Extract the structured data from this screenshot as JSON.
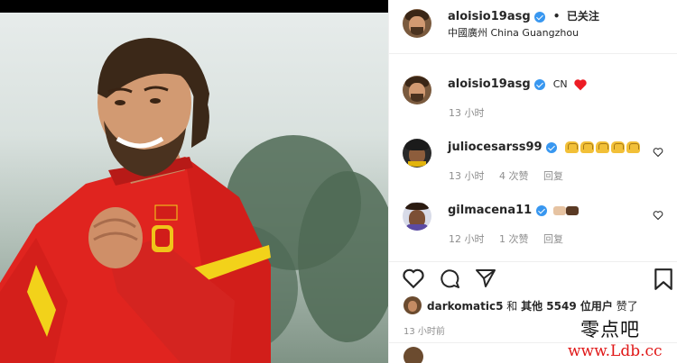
{
  "header": {
    "username": "aloisio19asg",
    "separator": "•",
    "follow_state": "已关注",
    "location": "中國廣州 China Guangzhou"
  },
  "caption": {
    "username": "aloisio19asg",
    "text": "CN",
    "time": "13 小时"
  },
  "comments": [
    {
      "username": "juliocesarss99",
      "time": "13 小时",
      "likes": "4 次赞",
      "reply": "回复",
      "emoji": "raising-hands x5"
    },
    {
      "username": "gilmacena11",
      "time": "12 小时",
      "likes": "1 次赞",
      "reply": "回复",
      "emoji": "handshake"
    }
  ],
  "likes": {
    "user": "darkomatic5",
    "and": "和",
    "others": "其他 5549 位用户",
    "suffix": "赞了"
  },
  "post_time": "13 小时前",
  "watermark": {
    "cn": "零点吧",
    "url": "www.Ldb.cc"
  },
  "colors": {
    "verified": "#3897f0",
    "heart": "#ed1c24",
    "jersey": "#e0241f",
    "jersey_stripe": "#f2d21a"
  }
}
